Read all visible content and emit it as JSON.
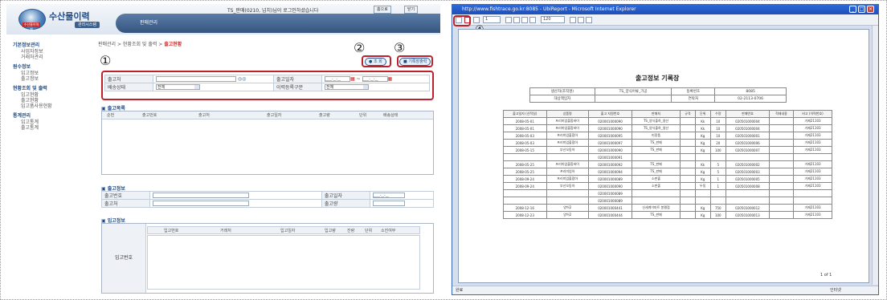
{
  "left": {
    "logo_title": "수산물이력",
    "logo_system": "관리시스템",
    "logo_sub": "수산물이력제",
    "nav_tab": "판매관리",
    "user_info": "TS_판매(0210, 넘치)님이 로그인하셨습니다",
    "home_btn": "홈으로",
    "close_btn": "닫기",
    "sidebar": [
      {
        "title": "기본정보관리",
        "items": [
          "사업자정보",
          "거래처관리"
        ]
      },
      {
        "title": "원수정보",
        "items": [
          "입고정보",
          "출고정보"
        ]
      },
      {
        "title": "현황조회 및 출력",
        "items": [
          "입고현황",
          "출고현황",
          "입고품사용현황"
        ]
      },
      {
        "title": "통계관리",
        "items": [
          "입고통계",
          "출고통계"
        ]
      }
    ],
    "breadcrumb_path": "판매관리 > 현황조회 및 출력 > ",
    "breadcrumb_current": "출고현황",
    "search_btn": "조 회",
    "print_btn": "기록장출력",
    "markers": [
      "①",
      "②",
      "③"
    ],
    "filter": {
      "dest_label": "출고처",
      "date_label": "출고일자",
      "date_from": "____-__-__",
      "date_to": "____-__-__",
      "tilde": "~",
      "delivery_label": "배송상태",
      "delivery_value": "전체",
      "history_label": "이력등록구분",
      "history_value": "전체"
    },
    "list_title": "출고목록",
    "list_cols": [
      "순번",
      "출고번호",
      "출고처",
      "출고일자",
      "출고량",
      "단위",
      "배송상태"
    ],
    "info_title": "출고정보",
    "info_fields": {
      "no": "출고번호",
      "date": "출고일자",
      "date_value": "____-__-__",
      "dest": "출고처",
      "qty": "출고량"
    },
    "in_title": "입고정보",
    "in_cols": [
      "입고번호",
      "거래처",
      "입고일자",
      "입고량",
      "잔량",
      "단위",
      "소진여부"
    ],
    "in_row_label": "입고번호"
  },
  "right": {
    "window_title": "http://www.fishtrace.go.kr:8085 - UbiReport - Microsoft Internet Explorer",
    "page_input": "1",
    "zoom": "120",
    "marker": "④",
    "doc_title": "출고정보 기록장",
    "info": {
      "producer_label": "생산자(조직명)",
      "producer": "TS_양식어류_가공",
      "reg_label": "등록번호",
      "reg": "8085",
      "manager_label": "대상책임자",
      "phone_label": "연락처",
      "phone": "02-2113-0706"
    },
    "cols": [
      "출고일자 (선적일)",
      "상품명",
      "출고 지원번호",
      "판매처",
      "규격",
      "단위",
      "수량",
      "판매번호",
      "적재내용",
      "비고 (이력번호)"
    ],
    "rows": [
      [
        "2008-05-01",
        "프리미엄출합바이",
        "020001000090",
        "TS_양식출하_생산",
        "",
        "Kk",
        "10",
        "020501000004",
        "",
        "거제21103"
      ],
      [
        "2008-05-01",
        "프리미엄출합바이",
        "020001000090",
        "TS_양식출하_생산",
        "",
        "Kk",
        "10",
        "020501000004",
        "",
        "거제21103"
      ],
      [
        "2008-05-03",
        "프리미엄출합아",
        "020001000095",
        "미정품",
        "",
        "Kg",
        "10",
        "020501000001",
        "",
        "거제21103"
      ],
      [
        "2008-05-03",
        "프리미엄출합아",
        "020001000097",
        "TS_판매",
        "",
        "Kg",
        "20",
        "020501000006",
        "",
        "거제21103"
      ],
      [
        "2008-05-15",
        "부산오동아",
        "020001000090",
        "TS_판매",
        "",
        "Kg",
        "100",
        "020501000007",
        "",
        "거제21103"
      ],
      [
        "",
        "",
        "020001000091",
        "",
        "",
        "",
        "",
        "",
        "",
        ""
      ],
      [
        "2008-05-25",
        "프리미엄출합바이",
        "020001000092",
        "TS_판매",
        "",
        "Kk",
        "5",
        "020501000002",
        "",
        "거제21103"
      ],
      [
        "2008-05-25",
        "프리미엄아",
        "020001000094",
        "TS_판매",
        "",
        "Kg",
        "5",
        "020501000003",
        "",
        "거제21103"
      ],
      [
        "2008-09-24",
        "프리미엄출합아",
        "020001000089",
        "소판출",
        "",
        "Kg",
        "1",
        "020501000005",
        "",
        "거제21103"
      ],
      [
        "2008-09-24",
        "부산오동아",
        "020001000090",
        "소판출",
        "",
        "두동",
        "1",
        "020501000008",
        "",
        "거제21103"
      ],
      [
        "",
        "",
        "020001000089",
        "",
        "",
        "",
        "",
        "",
        "",
        ""
      ],
      [
        "",
        "",
        "020001000089",
        "",
        "",
        "",
        "",
        "",
        "",
        ""
      ],
      [
        "2008-12-16",
        "양어2",
        "020001000441",
        "신세계이마트 봉평점",
        "",
        "Kg",
        "750",
        "020501000012",
        "",
        "거제21103"
      ],
      [
        "2008-12-23",
        "양어2",
        "020001000444",
        "TS_판매",
        "",
        "Kg",
        "100",
        "020501000013",
        "",
        "거제21103"
      ]
    ],
    "page_num": "1 of 1",
    "status_left": "완료",
    "status_right": "인터넷"
  }
}
